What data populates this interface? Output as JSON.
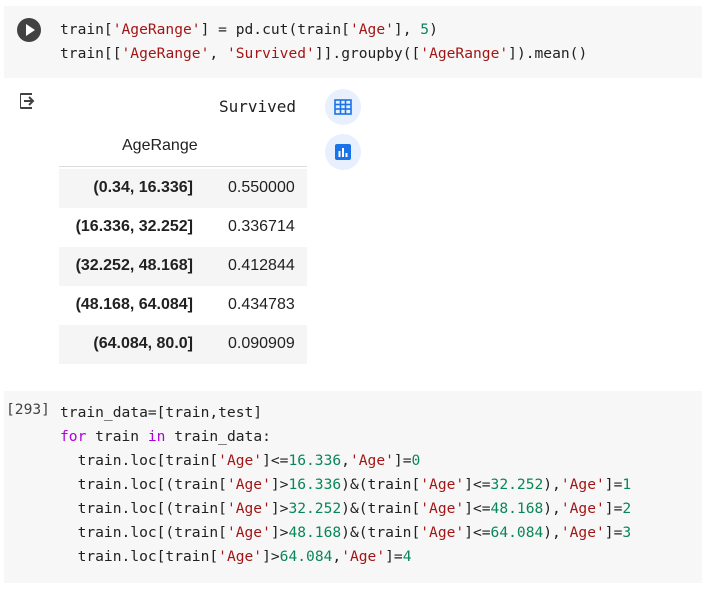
{
  "cell1": {
    "lines": [
      [
        {
          "t": "train[",
          "c": "c-default"
        },
        {
          "t": "'AgeRange'",
          "c": "c-str"
        },
        {
          "t": "] = pd.cut(train[",
          "c": "c-default"
        },
        {
          "t": "'Age'",
          "c": "c-str"
        },
        {
          "t": "], ",
          "c": "c-default"
        },
        {
          "t": "5",
          "c": "c-num"
        },
        {
          "t": ")",
          "c": "c-default"
        }
      ],
      [
        {
          "t": "train[[",
          "c": "c-default"
        },
        {
          "t": "'AgeRange'",
          "c": "c-str"
        },
        {
          "t": ", ",
          "c": "c-default"
        },
        {
          "t": "'Survived'",
          "c": "c-str"
        },
        {
          "t": "]].groupby([",
          "c": "c-default"
        },
        {
          "t": "'AgeRange'",
          "c": "c-str"
        },
        {
          "t": "]).mean()",
          "c": "c-default"
        }
      ]
    ]
  },
  "output": {
    "column_header": "Survived",
    "index_name": "AgeRange",
    "rows": [
      {
        "index": "(0.34, 16.336]",
        "value": "0.550000"
      },
      {
        "index": "(16.336, 32.252]",
        "value": "0.336714"
      },
      {
        "index": "(32.252, 48.168]",
        "value": "0.412844"
      },
      {
        "index": "(48.168, 64.084]",
        "value": "0.434783"
      },
      {
        "index": "(64.084, 80.0]",
        "value": "0.090909"
      }
    ],
    "icons": [
      "output-icon",
      "table-icon",
      "chart-icon"
    ]
  },
  "cell2": {
    "count": "[293]",
    "lines": [
      [
        {
          "t": "train_data=[train,test]",
          "c": "c-default"
        }
      ],
      [
        {
          "t": "for",
          "c": "c-kw"
        },
        {
          "t": " train ",
          "c": "c-default"
        },
        {
          "t": "in",
          "c": "c-kw"
        },
        {
          "t": " train_data:",
          "c": "c-default"
        }
      ],
      [
        {
          "t": "  train.loc[train[",
          "c": "c-default"
        },
        {
          "t": "'Age'",
          "c": "c-str"
        },
        {
          "t": "]<=",
          "c": "c-default"
        },
        {
          "t": "16.336",
          "c": "c-num"
        },
        {
          "t": ",",
          "c": "c-default"
        },
        {
          "t": "'Age'",
          "c": "c-str"
        },
        {
          "t": "]=",
          "c": "c-default"
        },
        {
          "t": "0",
          "c": "c-num"
        }
      ],
      [
        {
          "t": "  train.loc[(train[",
          "c": "c-default"
        },
        {
          "t": "'Age'",
          "c": "c-str"
        },
        {
          "t": "]>",
          "c": "c-default"
        },
        {
          "t": "16.336",
          "c": "c-num"
        },
        {
          "t": ")&(train[",
          "c": "c-default"
        },
        {
          "t": "'Age'",
          "c": "c-str"
        },
        {
          "t": "]<=",
          "c": "c-default"
        },
        {
          "t": "32.252",
          "c": "c-num"
        },
        {
          "t": "),",
          "c": "c-default"
        },
        {
          "t": "'Age'",
          "c": "c-str"
        },
        {
          "t": "]=",
          "c": "c-default"
        },
        {
          "t": "1",
          "c": "c-num"
        }
      ],
      [
        {
          "t": "  train.loc[(train[",
          "c": "c-default"
        },
        {
          "t": "'Age'",
          "c": "c-str"
        },
        {
          "t": "]>",
          "c": "c-default"
        },
        {
          "t": "32.252",
          "c": "c-num"
        },
        {
          "t": ")&(train[",
          "c": "c-default"
        },
        {
          "t": "'Age'",
          "c": "c-str"
        },
        {
          "t": "]<=",
          "c": "c-default"
        },
        {
          "t": "48.168",
          "c": "c-num"
        },
        {
          "t": "),",
          "c": "c-default"
        },
        {
          "t": "'Age'",
          "c": "c-str"
        },
        {
          "t": "]=",
          "c": "c-default"
        },
        {
          "t": "2",
          "c": "c-num"
        }
      ],
      [
        {
          "t": "  train.loc[(train[",
          "c": "c-default"
        },
        {
          "t": "'Age'",
          "c": "c-str"
        },
        {
          "t": "]>",
          "c": "c-default"
        },
        {
          "t": "48.168",
          "c": "c-num"
        },
        {
          "t": ")&(train[",
          "c": "c-default"
        },
        {
          "t": "'Age'",
          "c": "c-str"
        },
        {
          "t": "]<=",
          "c": "c-default"
        },
        {
          "t": "64.084",
          "c": "c-num"
        },
        {
          "t": "),",
          "c": "c-default"
        },
        {
          "t": "'Age'",
          "c": "c-str"
        },
        {
          "t": "]=",
          "c": "c-default"
        },
        {
          "t": "3",
          "c": "c-num"
        }
      ],
      [
        {
          "t": "  train.loc[train[",
          "c": "c-default"
        },
        {
          "t": "'Age'",
          "c": "c-str"
        },
        {
          "t": "]>",
          "c": "c-default"
        },
        {
          "t": "64.084",
          "c": "c-num"
        },
        {
          "t": ",",
          "c": "c-default"
        },
        {
          "t": "'Age'",
          "c": "c-str"
        },
        {
          "t": "]=",
          "c": "c-default"
        },
        {
          "t": "4",
          "c": "c-num"
        }
      ]
    ]
  },
  "colors": {
    "cell_bg": "#f7f7f7",
    "string": "#a31515",
    "number": "#098658",
    "keyword": "#af00db",
    "accent": "#1a73e8",
    "accent_bg": "#e8f0fe",
    "row_alt": "#f5f5f5"
  }
}
